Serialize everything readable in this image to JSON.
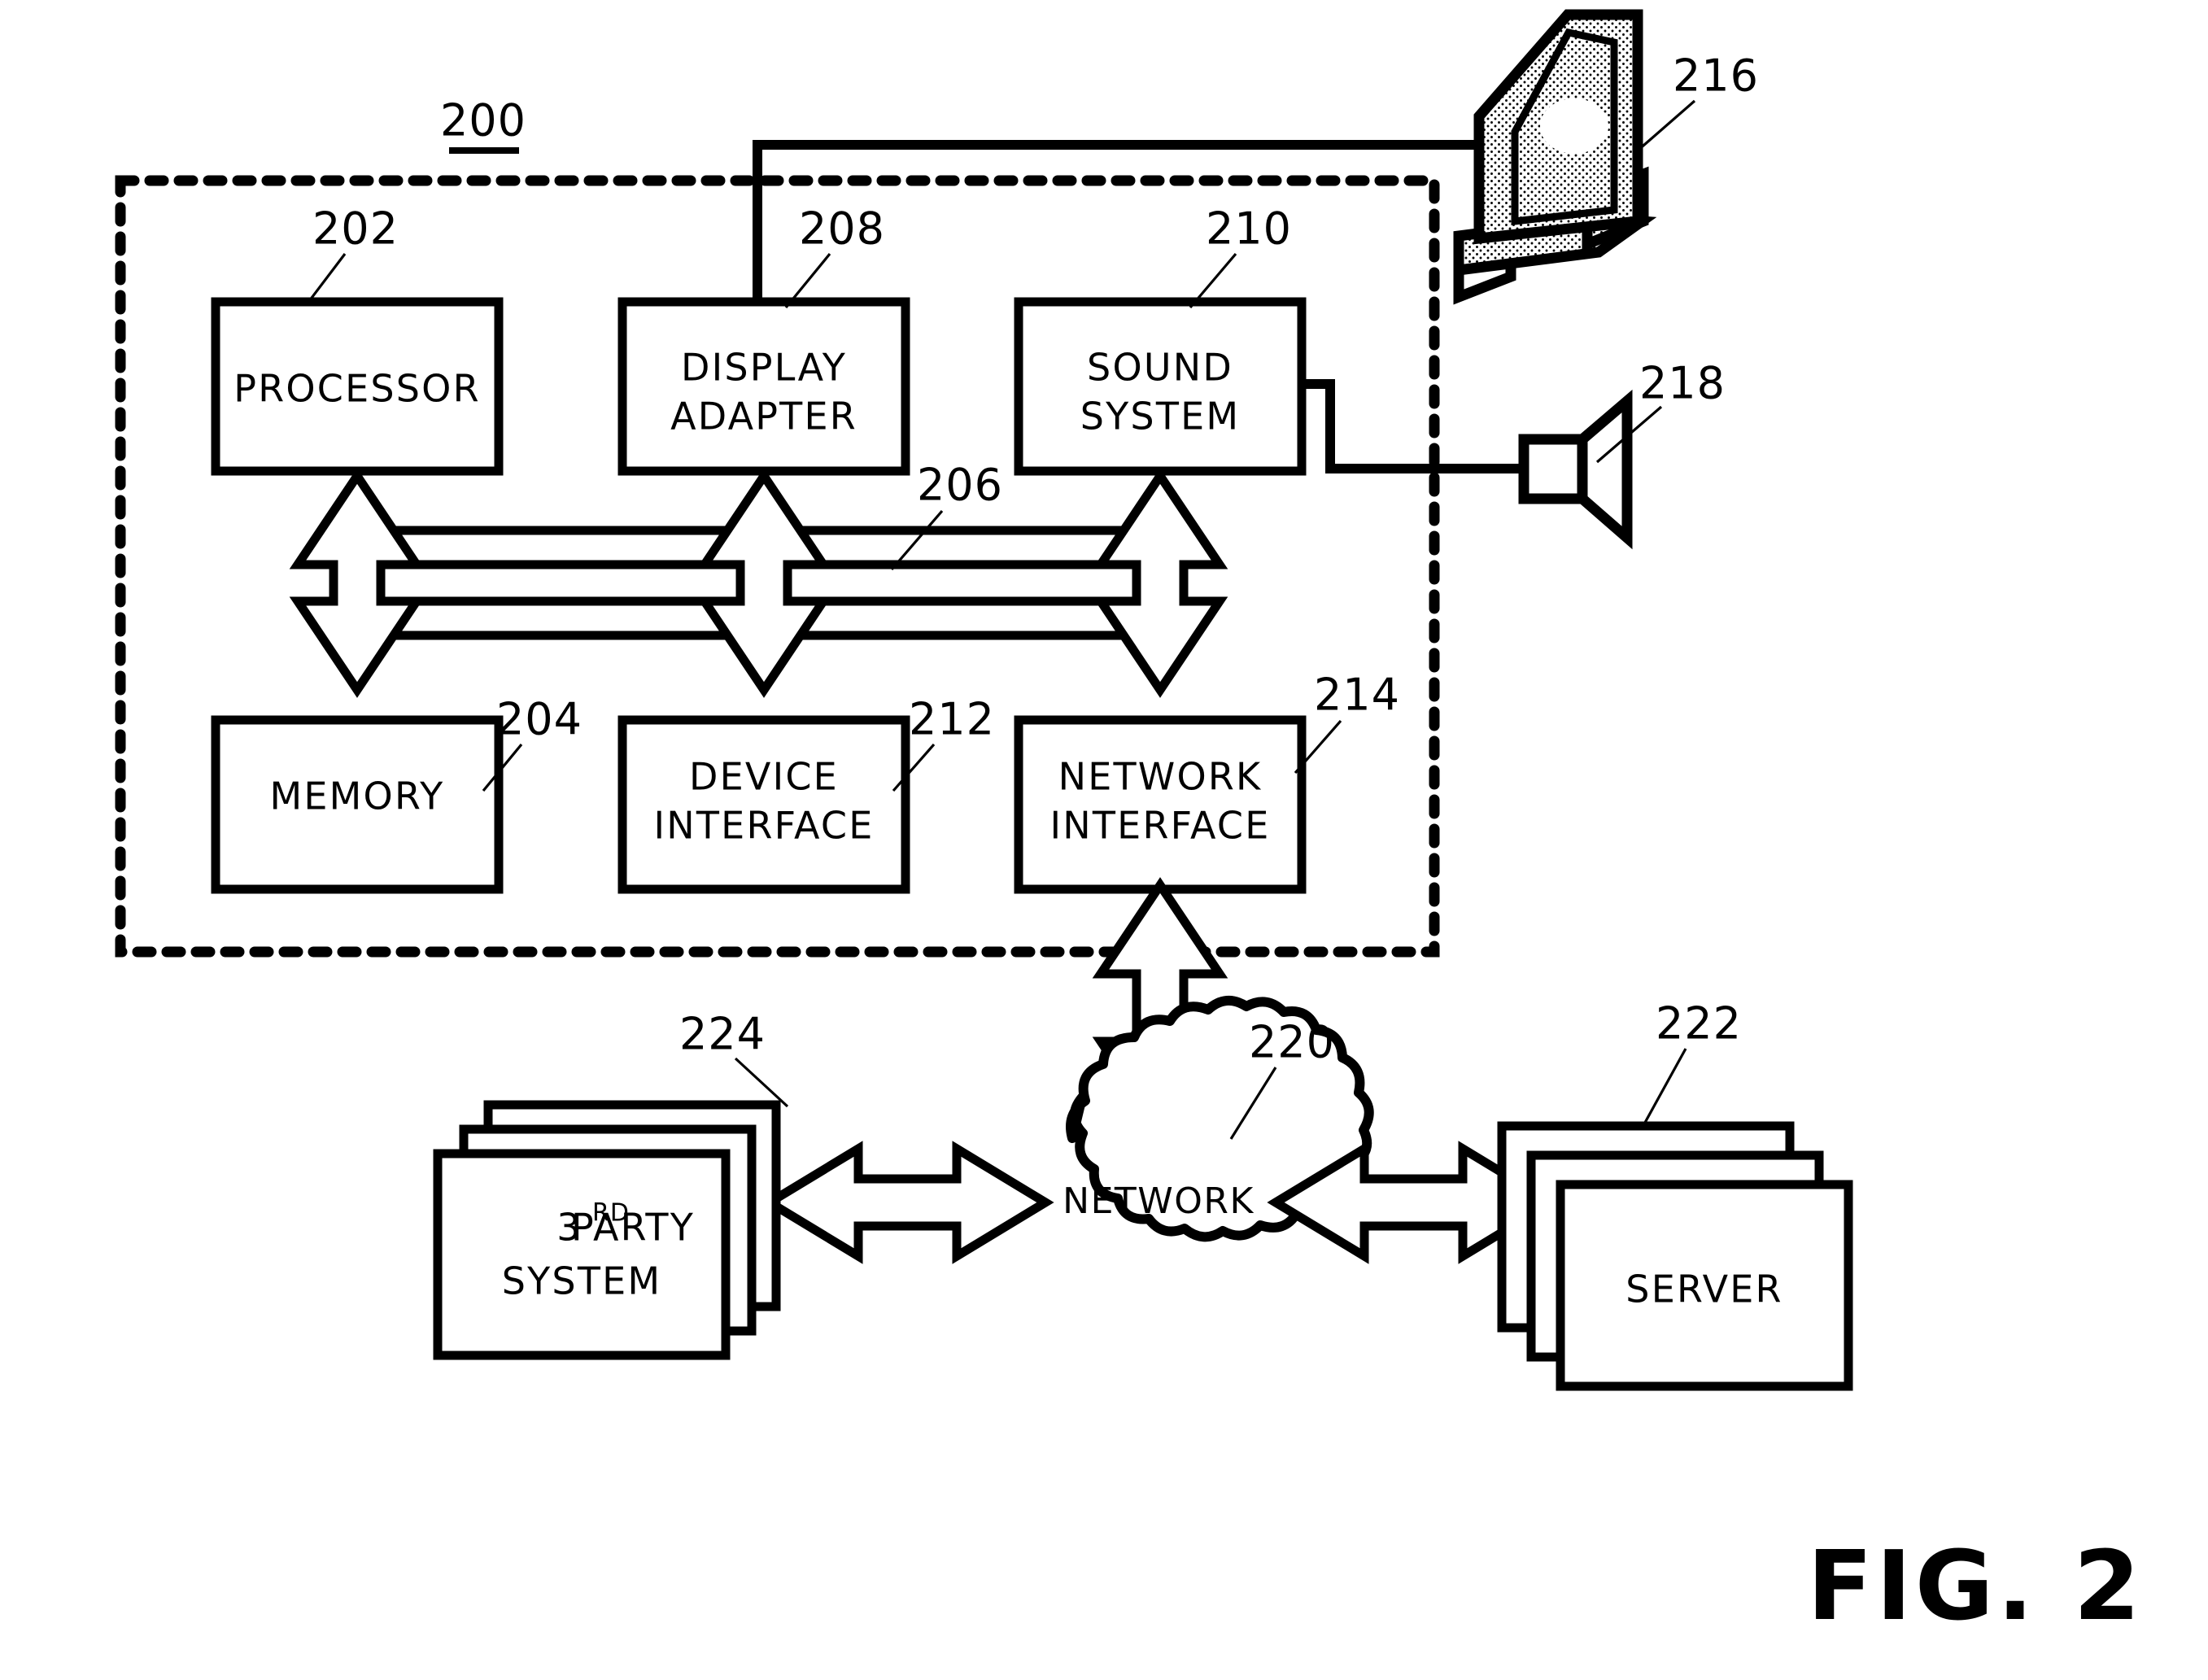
{
  "figure": {
    "label": "FIG. 2",
    "system_ref": "200"
  },
  "blocks": [
    {
      "id": "processor",
      "ref": "202",
      "line1": "PROCESSOR",
      "line2": ""
    },
    {
      "id": "display-adapter",
      "ref": "208",
      "line1": "DISPLAY",
      "line2": "ADAPTER"
    },
    {
      "id": "sound-system",
      "ref": "210",
      "line1": "SOUND",
      "line2": "SYSTEM"
    },
    {
      "id": "memory",
      "ref": "204",
      "line1": "MEMORY",
      "line2": ""
    },
    {
      "id": "device-interface",
      "ref": "212",
      "line1": "DEVICE",
      "line2": "INTERFACE"
    },
    {
      "id": "network-interface",
      "ref": "214",
      "line1": "NETWORK",
      "line2": "INTERFACE"
    }
  ],
  "bus": {
    "ref": "206"
  },
  "peripherals": [
    {
      "id": "display",
      "ref": "216",
      "label": ""
    },
    {
      "id": "speaker",
      "ref": "218",
      "label": ""
    }
  ],
  "network": {
    "ref": "220",
    "label": "NETWORK"
  },
  "external_systems": [
    {
      "id": "third-party-system",
      "ref": "224",
      "line1_main": "3",
      "line1_sup": "RD",
      "line1_rest": " PARTY",
      "line2": "SYSTEM"
    },
    {
      "id": "server",
      "ref": "222",
      "line1_main": "SERVER",
      "line1_sup": "",
      "line1_rest": "",
      "line2": ""
    }
  ],
  "colors": {
    "ink": "#000000",
    "paper": "#ffffff"
  }
}
